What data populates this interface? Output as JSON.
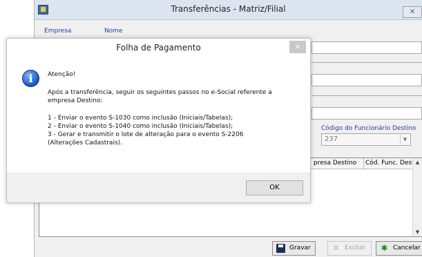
{
  "background_window": {
    "title": "Transferências - Matriz/Filial",
    "close_icon": "close-icon",
    "labels": {
      "empresa": "Empresa",
      "nome": "Nome"
    },
    "funcionario_destino": {
      "label": "Código do Funcionário Destino",
      "value": "237"
    },
    "grid": {
      "columns": [
        "presa Destino",
        "Cód. Func. Destino"
      ]
    },
    "toolbar": {
      "gravar": "Gravar",
      "excluir": "Excluir",
      "cancelar": "Cancelar"
    }
  },
  "dialog": {
    "title": "Folha de Pagamento",
    "close_symbol": "×",
    "icon": "info-icon",
    "heading": "Atenção!",
    "paragraph_lines": [
      "Após a transferência, seguir os seguintes passos no e-Social referente a",
      "empresa Destino:"
    ],
    "step_lines": [
      "1 - Enviar o evento S-1030 como inclusão (Iniciais/Tabelas);",
      "2 - Enviar o evento S-1040 como inclusão (Iniciais/Tabelas);",
      "3 - Gerar e transmitir o lote de alteração para o evento S-2206",
      "(Alterações Cadastrais)."
    ],
    "ok_label": "OK"
  },
  "colors": {
    "dialog_close_bg": "#c8c8c8",
    "link_label": "#1f3f9c",
    "info_icon": "#1957c5"
  }
}
